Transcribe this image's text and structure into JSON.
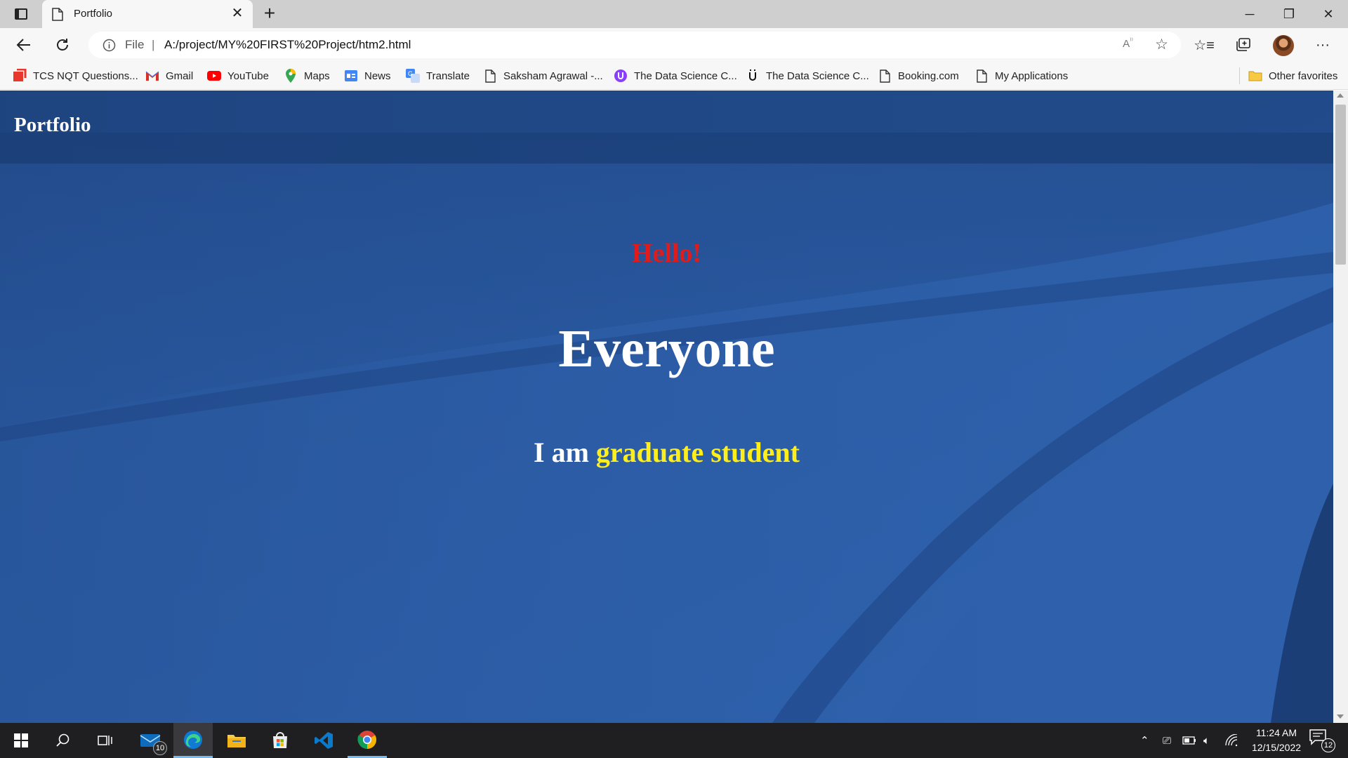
{
  "browser": {
    "tab": {
      "title": "Portfolio",
      "icon": "document-icon"
    },
    "address": {
      "scheme_label": "File",
      "url": "A:/project/MY%20FIRST%20Project/htm2.html",
      "read_aloud_label": "A ʼʼ"
    },
    "favorites": [
      {
        "label": "TCS NQT Questions...",
        "icon": "tcs-icon"
      },
      {
        "label": "Gmail",
        "icon": "gmail-icon"
      },
      {
        "label": "YouTube",
        "icon": "youtube-icon"
      },
      {
        "label": "Maps",
        "icon": "maps-icon"
      },
      {
        "label": "News",
        "icon": "news-icon"
      },
      {
        "label": "Translate",
        "icon": "translate-icon"
      },
      {
        "label": "Saksham Agrawal -...",
        "icon": "document-icon"
      },
      {
        "label": "The Data Science C...",
        "icon": "data-science-icon"
      },
      {
        "label": "The Data Science C...",
        "icon": "data-science-icon"
      },
      {
        "label": "Booking.com",
        "icon": "document-icon"
      },
      {
        "label": "My Applications",
        "icon": "document-icon"
      }
    ],
    "other_favorites": "Other favorites"
  },
  "page": {
    "brand": "Portfolio",
    "greeting": "Hello!",
    "headline": "Everyone",
    "tagline_prefix": "I am ",
    "tagline_highlight": "graduate student"
  },
  "colors": {
    "page_background": "#2d5ea9",
    "greeting": "#e01b1b",
    "highlight": "#ffee1a",
    "text": "#ffffff"
  },
  "taskbar": {
    "mail_badge": "10",
    "time": "11:24 AM",
    "date": "12/15/2022",
    "notifications": "12",
    "apps": [
      "start-icon",
      "search-icon",
      "task-view-icon",
      "mail-icon",
      "edge-icon",
      "file-explorer-icon",
      "store-icon",
      "vscode-icon",
      "chrome-icon"
    ]
  }
}
